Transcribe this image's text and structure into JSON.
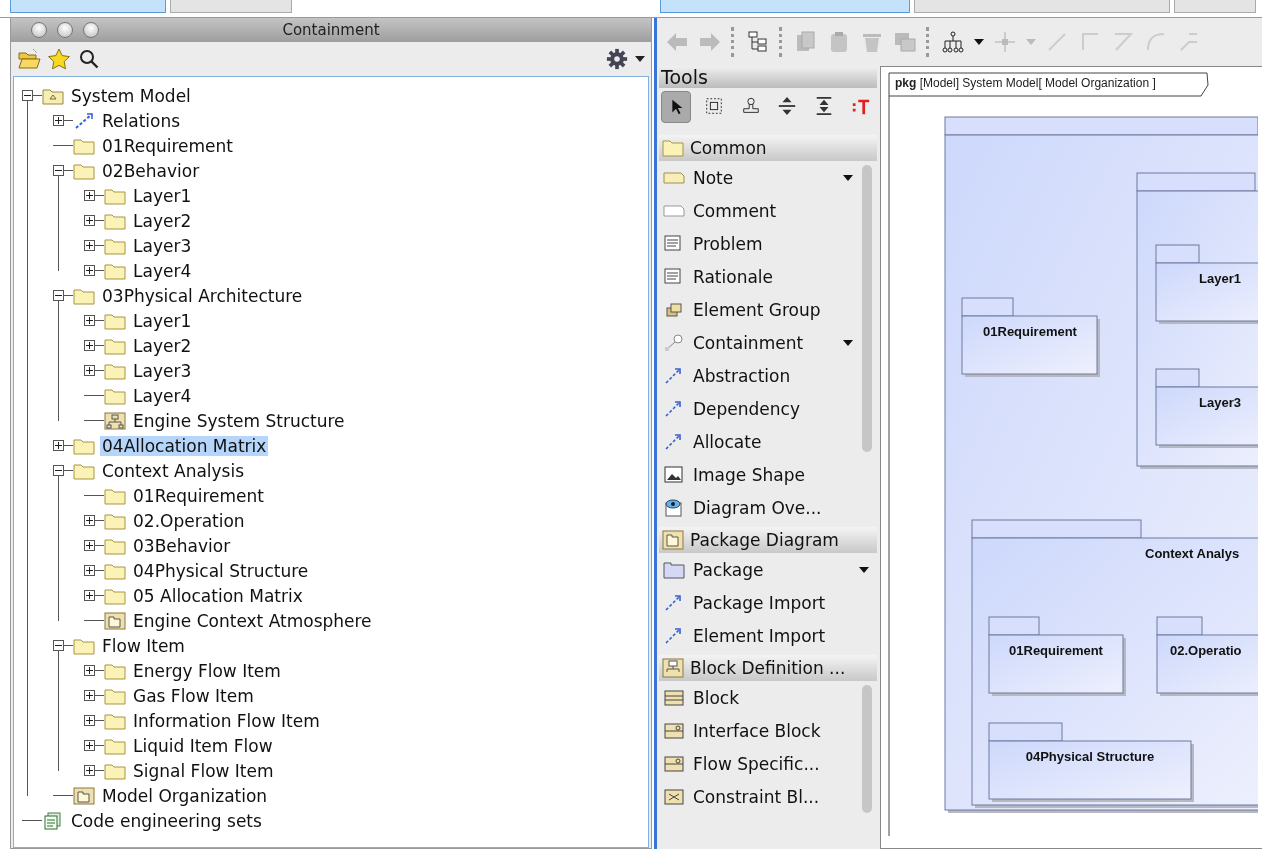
{
  "left_tabs": [
    {
      "selected": true
    },
    {
      "selected": false
    }
  ],
  "containment": {
    "title": "Containment",
    "tree": [
      {
        "label": "System Model",
        "kind": "model",
        "expanded": true,
        "selected": false,
        "children": [
          {
            "label": "Relations",
            "kind": "relations",
            "expanded": false,
            "selected": false
          },
          {
            "label": "01Requirement",
            "kind": "package",
            "selected": false
          },
          {
            "label": "02Behavior",
            "kind": "package",
            "expanded": true,
            "selected": false,
            "children": [
              {
                "label": "Layer1",
                "kind": "package",
                "expanded": false,
                "selected": false
              },
              {
                "label": "Layer2",
                "kind": "package",
                "expanded": false,
                "selected": false
              },
              {
                "label": "Layer3",
                "kind": "package",
                "expanded": false,
                "selected": false
              },
              {
                "label": "Layer4",
                "kind": "package",
                "expanded": false,
                "selected": false
              }
            ]
          },
          {
            "label": "03Physical Architecture",
            "kind": "package",
            "expanded": true,
            "selected": false,
            "children": [
              {
                "label": "Layer1",
                "kind": "package",
                "expanded": false,
                "selected": false
              },
              {
                "label": "Layer2",
                "kind": "package",
                "expanded": false,
                "selected": false
              },
              {
                "label": "Layer3",
                "kind": "package",
                "expanded": false,
                "selected": false
              },
              {
                "label": "Layer4",
                "kind": "package",
                "selected": false
              },
              {
                "label": "Engine System Structure",
                "kind": "diagram",
                "selected": false
              }
            ]
          },
          {
            "label": "04Allocation Matrix",
            "kind": "package",
            "expanded": false,
            "selected": true
          },
          {
            "label": "Context Analysis",
            "kind": "package",
            "expanded": true,
            "selected": false,
            "children": [
              {
                "label": "01Requirement",
                "kind": "package",
                "selected": false
              },
              {
                "label": "02.Operation",
                "kind": "package",
                "expanded": false,
                "selected": false
              },
              {
                "label": "03Behavior",
                "kind": "package",
                "expanded": false,
                "selected": false
              },
              {
                "label": "04Physical Structure",
                "kind": "package",
                "expanded": false,
                "selected": false
              },
              {
                "label": "05 Allocation Matrix",
                "kind": "package",
                "expanded": false,
                "selected": false
              },
              {
                "label": "Engine Context Atmosphere",
                "kind": "package_diagram",
                "selected": false
              }
            ]
          },
          {
            "label": "Flow Item",
            "kind": "package",
            "expanded": true,
            "selected": false,
            "children": [
              {
                "label": "Energy Flow Item",
                "kind": "package",
                "expanded": false,
                "selected": false
              },
              {
                "label": "Gas Flow Item",
                "kind": "package",
                "expanded": false,
                "selected": false
              },
              {
                "label": "Information Flow Item",
                "kind": "package",
                "expanded": false,
                "selected": false
              },
              {
                "label": "Liquid Item Flow",
                "kind": "package",
                "expanded": false,
                "selected": false
              },
              {
                "label": "Signal Flow Item",
                "kind": "package",
                "expanded": false,
                "selected": false
              }
            ]
          },
          {
            "label": "Model Organization",
            "kind": "package_diagram",
            "selected": false
          }
        ]
      },
      {
        "label": "Code engineering sets",
        "kind": "code_set",
        "selected": false
      }
    ]
  },
  "right_tabs": [
    {
      "selected": true
    },
    {
      "selected": false
    },
    {
      "selected": false
    }
  ],
  "palette": {
    "title": "Tools",
    "tools": [
      {
        "selected": true
      },
      {
        "selected": false
      },
      {
        "selected": false
      },
      {
        "selected": false
      },
      {
        "selected": false
      },
      {
        "selected": false
      }
    ],
    "sections": [
      {
        "title": "Common",
        "items": [
          {
            "label": "Note",
            "has_menu": true
          },
          {
            "label": "Comment",
            "has_menu": false
          },
          {
            "label": "Problem",
            "has_menu": false
          },
          {
            "label": "Rationale",
            "has_menu": false
          },
          {
            "label": "Element Group",
            "has_menu": false
          },
          {
            "label": "Containment",
            "has_menu": true
          },
          {
            "label": "Abstraction",
            "has_menu": false
          },
          {
            "label": "Dependency",
            "has_menu": false
          },
          {
            "label": "Allocate",
            "has_menu": false
          },
          {
            "label": "Image Shape",
            "has_menu": false
          },
          {
            "label": "Diagram Ove...",
            "has_menu": false
          }
        ]
      },
      {
        "title": "Package Diagram",
        "items": [
          {
            "label": "Package",
            "has_menu": true
          },
          {
            "label": "Package Import",
            "has_menu": false
          },
          {
            "label": "Element Import",
            "has_menu": false
          }
        ]
      },
      {
        "title": "Block Definition ...",
        "items": [
          {
            "label": "Block",
            "has_menu": false
          },
          {
            "label": "Interface Block",
            "has_menu": false
          },
          {
            "label": "Flow Specific...",
            "has_menu": false
          },
          {
            "label": "Constraint Bl...",
            "has_menu": false
          }
        ]
      }
    ]
  },
  "diagram": {
    "heading": "**pkg** [Model] System Model[ Model Organization ]",
    "packages": [
      {
        "children": [
          {
            "children": [
              {
                "name": "Layer1"
              },
              {
                "name": "Layer3"
              }
            ]
          },
          {
            "name": "01Requirement"
          },
          {
            "name": "Context Analys",
            "children": [
              {
                "name": "01Requirement"
              },
              {
                "name": "02.Operatio"
              },
              {
                "name": "04Physical Structure"
              }
            ]
          }
        ]
      }
    ]
  }
}
